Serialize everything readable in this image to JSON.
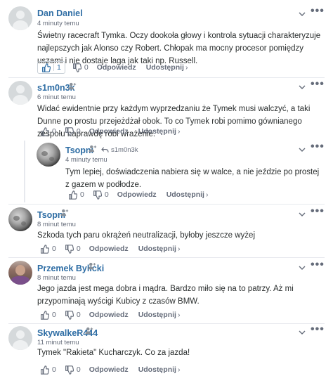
{
  "labels": {
    "reply": "Odpowiedz",
    "share": "Udostępnij",
    "share_chevron": "›"
  },
  "comments": [
    {
      "author": "Dan Daniel",
      "time": "4 minuty temu",
      "text": "Świetny racecraft Tymka. Oczy dookoła głowy i kontrola sytuacji charakteryzuje najlepszych jak Alonso czy Robert. Chłopak ma mocny procesor pomiędzy uszami i nie dostaje laga jak taki np. Russell.",
      "upvotes": "1",
      "downvotes": "0",
      "avatar": "default-avatar"
    },
    {
      "author": "s1m0n3k",
      "time": "6 minut temu",
      "text": "Widać ewidentnie przy każdym wyprzedzaniu że Tymek musi walczyć, a taki Dunne po prostu przejeżdżał obok. To co Tymek robi pomimo gównianego zespołu naprawdę robi wrażenie.",
      "upvotes": "0",
      "downvotes": "0",
      "avatar": "default-avatar"
    },
    {
      "author": "Tsopni",
      "reply_to": "s1m0n3k",
      "time": "4 minuty temu",
      "text": "Tym lepiej, doświadczenia nabiera się w walce, a nie jeździe po prostej z gazem w podłodze.",
      "upvotes": "0",
      "downvotes": "0",
      "avatar": "moon-avatar"
    },
    {
      "author": "Tsopni",
      "time": "8 minut temu",
      "text": "Szkoda tych paru okrążeń neutralizacji, byłoby jeszcze wyżej",
      "upvotes": "0",
      "downvotes": "0",
      "avatar": "moon-avatar"
    },
    {
      "author": "Przemek Bylicki",
      "time": "8 minut temu",
      "text": "Jego jazda jest mega dobra i mądra. Bardzo miło się na to patrzy. Aż mi przypominają wyścigi Kubicy z czasów BMW.",
      "upvotes": "0",
      "downvotes": "0",
      "avatar": "photo-avatar"
    },
    {
      "author": "SkywalkeR444",
      "time": "11 minut temu",
      "text": "Tymek \"Rakieta\" Kucharczyk. Co za jazda!",
      "upvotes": "0",
      "downvotes": "0",
      "avatar": "default-avatar"
    }
  ],
  "colors": {
    "link": "#2e6da4",
    "muted": "#656c7a",
    "text": "#2a2e2e"
  }
}
